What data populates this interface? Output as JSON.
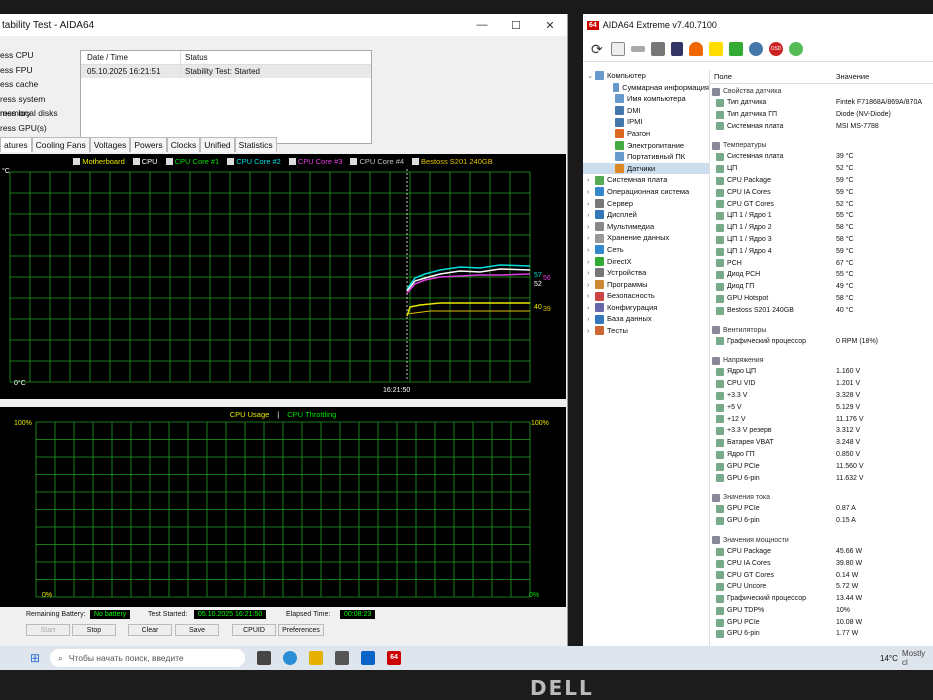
{
  "stability": {
    "title": "tability Test - AIDA64",
    "stress_items": [
      "ess CPU",
      "ess FPU",
      "ess cache",
      "ress system memory",
      "ress local disks",
      "ress GPU(s)"
    ],
    "status_table": {
      "headers": [
        "Date / Time",
        "Status"
      ],
      "rows": [
        [
          "05.10.2025 16:21:51",
          "Stability Test: Started"
        ]
      ]
    },
    "tabs": [
      "atures",
      "Cooling Fans",
      "Voltages",
      "Powers",
      "Clocks",
      "Unified",
      "Statistics"
    ],
    "temp_graph": {
      "legend": [
        {
          "label": "Motherboard",
          "color": "#e8e800"
        },
        {
          "label": "CPU",
          "color": "#ffffff"
        },
        {
          "label": "CPU Core #1",
          "color": "#00e000"
        },
        {
          "label": "CPU Core #2",
          "color": "#00e0e0"
        },
        {
          "label": "CPU Core #3",
          "color": "#e040e0"
        },
        {
          "label": "CPU Core #4",
          "color": "#c0c0c0"
        },
        {
          "label": "Bestoss S201 240GB",
          "color": "#e0c000"
        }
      ],
      "y_top": "°C",
      "y_bottom": "0°C",
      "x_label": "16:21:50",
      "end_values": [
        "57",
        "56",
        "52",
        "40",
        "39"
      ]
    },
    "usage_graph": {
      "legend_a": "CPU Usage",
      "legend_b": "CPU Throttling",
      "sep": "|",
      "top_left": "100%",
      "top_right": "100%",
      "bottom_left": "0%",
      "bottom_right": "0%"
    },
    "footer": {
      "battery_label": "Remaining Battery:",
      "battery_value": "No battery",
      "started_label": "Test Started:",
      "started_value": "05.10.2025 16:21:50",
      "elapsed_label": "Elapsed Time:",
      "elapsed_value": "00:08:23",
      "buttons": [
        "Start",
        "Stop",
        "Clear",
        "Save",
        "CPUID",
        "Preferences"
      ]
    }
  },
  "aida": {
    "title": "AIDA64 Extreme v7.40.7100",
    "logo": "64",
    "tree": [
      {
        "label": "Компьютер",
        "level": 0,
        "color": "#6699cc"
      },
      {
        "label": "Суммарная информация",
        "level": 1,
        "color": "#6699cc"
      },
      {
        "label": "Имя компьютера",
        "level": 1,
        "color": "#6699cc"
      },
      {
        "label": "DMI",
        "level": 1,
        "color": "#4477aa"
      },
      {
        "label": "IPMI",
        "level": 1,
        "color": "#4477aa"
      },
      {
        "label": "Разгон",
        "level": 1,
        "color": "#dd6622"
      },
      {
        "label": "Электропитание",
        "level": 1,
        "color": "#44aa44"
      },
      {
        "label": "Портативный ПК",
        "level": 1,
        "color": "#6699cc"
      },
      {
        "label": "Датчики",
        "level": 1,
        "color": "#dd8822",
        "selected": true
      },
      {
        "label": "Системная плата",
        "level": 0,
        "color": "#55aa55"
      },
      {
        "label": "Операционная система",
        "level": 0,
        "color": "#3388cc"
      },
      {
        "label": "Сервер",
        "level": 0,
        "color": "#777777"
      },
      {
        "label": "Дисплей",
        "level": 0,
        "color": "#3377bb"
      },
      {
        "label": "Мультимедиа",
        "level": 0,
        "color": "#888888"
      },
      {
        "label": "Хранение данных",
        "level": 0,
        "color": "#999999"
      },
      {
        "label": "Сеть",
        "level": 0,
        "color": "#3388cc"
      },
      {
        "label": "DirectX",
        "level": 0,
        "color": "#33aa33"
      },
      {
        "label": "Устройства",
        "level": 0,
        "color": "#777777"
      },
      {
        "label": "Программы",
        "level": 0,
        "color": "#cc8833"
      },
      {
        "label": "Безопасность",
        "level": 0,
        "color": "#cc4444"
      },
      {
        "label": "Конфигурация",
        "level": 0,
        "color": "#6666aa"
      },
      {
        "label": "База данных",
        "level": 0,
        "color": "#3377bb"
      },
      {
        "label": "Тесты",
        "level": 0,
        "color": "#cc6633"
      }
    ],
    "columns": [
      "Поле",
      "Значение"
    ],
    "sections": [
      {
        "title": "Свойства датчика",
        "items": [
          [
            "Тип датчика",
            "Fintek F71868A/869A/870A"
          ],
          [
            "Тип датчика ГП",
            "Diode  (NV-Diode)"
          ],
          [
            "Системная плата",
            "MSI MS-7788"
          ]
        ]
      },
      {
        "title": "Температуры",
        "items": [
          [
            "Системная плата",
            "39 °C"
          ],
          [
            "ЦП",
            "52 °C"
          ],
          [
            "CPU Package",
            "59 °C"
          ],
          [
            "CPU IA Cores",
            "59 °C"
          ],
          [
            "CPU GT Cores",
            "52 °C"
          ],
          [
            "ЦП 1 / Ядро 1",
            "55 °C"
          ],
          [
            "ЦП 1 / Ядро 2",
            "58 °C"
          ],
          [
            "ЦП 1 / Ядро 3",
            "58 °C"
          ],
          [
            "ЦП 1 / Ядро 4",
            "59 °C"
          ],
          [
            "PCH",
            "67 °C"
          ],
          [
            "Диод PCH",
            "55 °C"
          ],
          [
            "Диод ГП",
            "49 °C"
          ],
          [
            "GPU Hotspot",
            "58 °C"
          ],
          [
            "Bestoss S201 240GB",
            "40 °C"
          ]
        ]
      },
      {
        "title": "Вентиляторы",
        "items": [
          [
            "Графический процессор",
            "0 RPM  (18%)"
          ]
        ]
      },
      {
        "title": "Напряжения",
        "items": [
          [
            "Ядро ЦП",
            "1.160 V"
          ],
          [
            "CPU VID",
            "1.201 V"
          ],
          [
            "+3.3 V",
            "3.328 V"
          ],
          [
            "+5 V",
            "5.129 V"
          ],
          [
            "+12 V",
            "11.176 V"
          ],
          [
            "+3.3 V резерв",
            "3.312 V"
          ],
          [
            "Батарея VBAT",
            "3.248 V"
          ],
          [
            "Ядро ГП",
            "0.850 V"
          ],
          [
            "GPU PCIe",
            "11.560 V"
          ],
          [
            "GPU 6-pin",
            "11.632 V"
          ]
        ]
      },
      {
        "title": "Значения тока",
        "items": [
          [
            "GPU PCIe",
            "0.87 A"
          ],
          [
            "GPU 6-pin",
            "0.15 A"
          ]
        ]
      },
      {
        "title": "Значения мощности",
        "items": [
          [
            "CPU Package",
            "45.66 W"
          ],
          [
            "CPU IA Cores",
            "39.80 W"
          ],
          [
            "CPU GT Cores",
            "0.14 W"
          ],
          [
            "CPU Uncore",
            "5.72 W"
          ],
          [
            "Графический процессор",
            "13.44 W"
          ],
          [
            "GPU TDP%",
            "10%"
          ],
          [
            "GPU PCIe",
            "10.08 W"
          ],
          [
            "GPU 6-pin",
            "1.77 W"
          ]
        ]
      }
    ]
  },
  "taskbar": {
    "search_placeholder": "Чтобы начать поиск, введите",
    "weather": "14°C",
    "weather_desc": "Mostly cl"
  },
  "brand": "DELL"
}
